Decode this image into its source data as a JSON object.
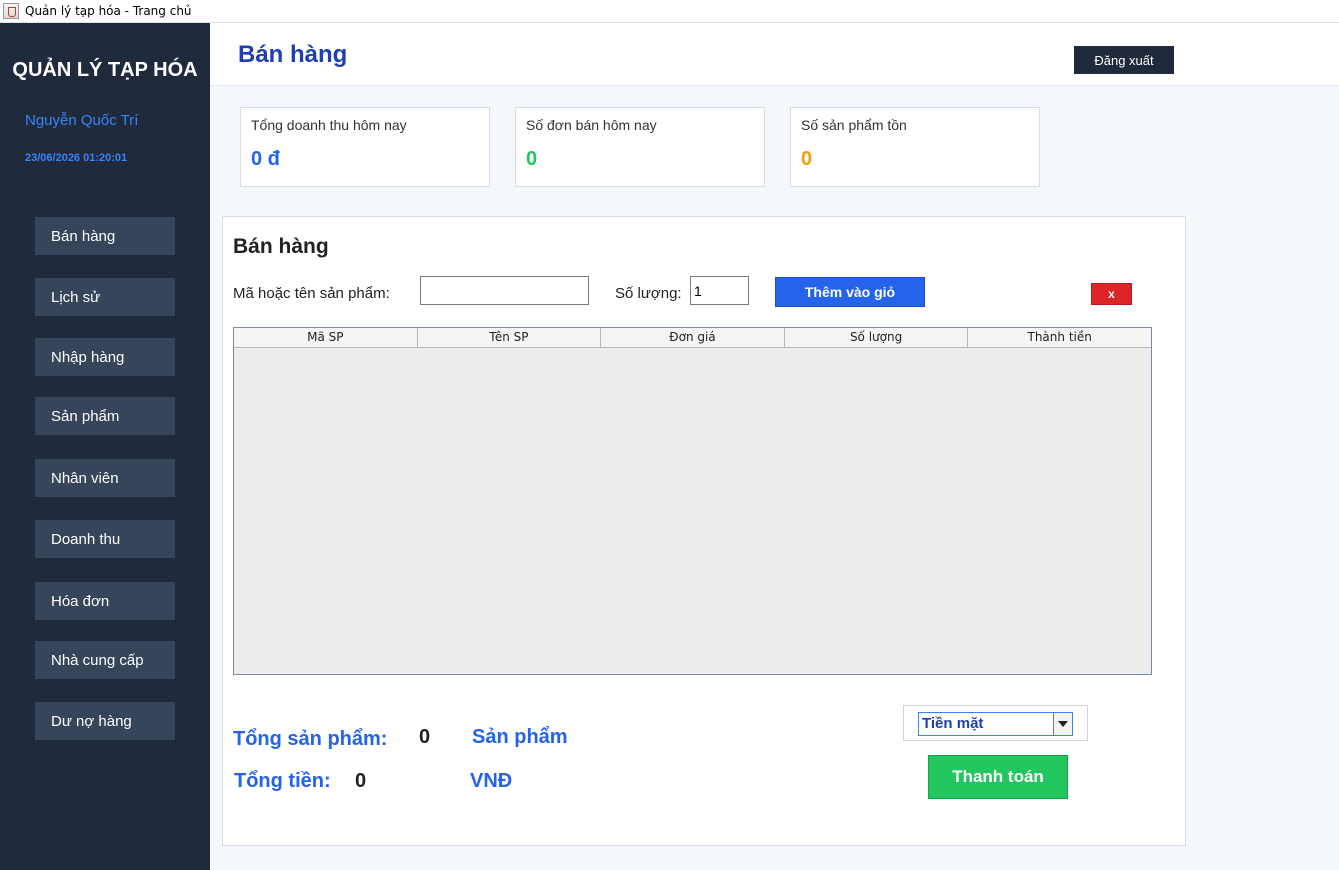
{
  "window": {
    "title": "Quản lý tạp hóa - Trang chủ"
  },
  "sidebar": {
    "app_name": "QUẢN LÝ TẠP HÓA",
    "user_name": "Nguyễn Quốc Trí",
    "datetime": "23/06/2026 01:20:01",
    "items": [
      {
        "label": "Bán hàng"
      },
      {
        "label": "Lịch sử"
      },
      {
        "label": "Nhập hàng"
      },
      {
        "label": "Sản phẩm"
      },
      {
        "label": "Nhân viên"
      },
      {
        "label": "Doanh thu"
      },
      {
        "label": "Hóa đơn"
      },
      {
        "label": "Nhà cung cấp"
      },
      {
        "label": "Dư nợ hàng"
      }
    ]
  },
  "header": {
    "title": "Bán hàng",
    "logout_label": "Đăng xuất"
  },
  "stats": [
    {
      "label": "Tổng doanh thu hôm nay",
      "value": "0 đ",
      "color": "#2563eb"
    },
    {
      "label": "Số đơn bán hôm nay",
      "value": "0",
      "color": "#22c55e"
    },
    {
      "label": "Số sản phẩm tồn",
      "value": "0",
      "color": "#f59e0b"
    }
  ],
  "sale": {
    "title": "Bán hàng",
    "product_label": "Mã hoặc tên sản phẩm:",
    "product_value": "",
    "qty_label": "Số lượng:",
    "qty_value": "1",
    "add_button": "Thêm vào giỏ",
    "remove_button": "x",
    "columns": [
      "Mã SP",
      "Tên SP",
      "Đơn giá",
      "Số lượng",
      "Thành tiền"
    ],
    "rows": [],
    "total_products_label": "Tổng sản phẩm:",
    "total_products_value": "0",
    "total_products_unit": "Sản phẩm",
    "total_money_label": "Tổng tiền:",
    "total_money_value": "0",
    "total_money_unit": "VNĐ",
    "payment_method": "Tiền mặt",
    "pay_button": "Thanh toán"
  },
  "colors": {
    "sidebar_bg": "#1f2a3d",
    "nav_item_bg": "#364559",
    "accent_blue": "#2563eb",
    "remove_red": "#dc2626",
    "pay_green": "#22c55e"
  }
}
